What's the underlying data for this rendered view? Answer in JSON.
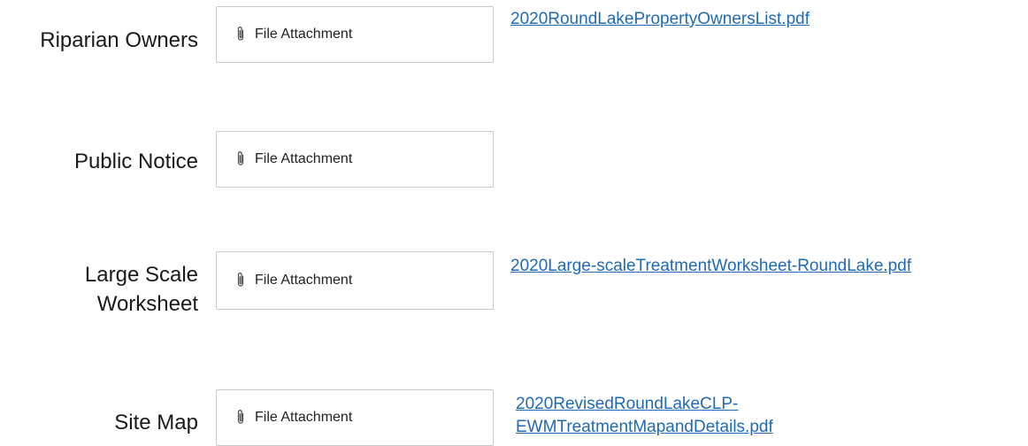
{
  "rows": [
    {
      "label": "Riparian Owners",
      "attachment_label": "File Attachment",
      "icon": "paperclip-icon",
      "file_link": "2020RoundLakePropertyOwnersList.pdf"
    },
    {
      "label": "Public Notice",
      "attachment_label": "File Attachment",
      "icon": "paperclip-icon"
    },
    {
      "label_line1": "Large Scale",
      "label_line2": "Worksheet",
      "attachment_label": "File Attachment",
      "icon": "paperclip-icon",
      "file_link": "2020Large-scaleTreatmentWorksheet-RoundLake.pdf"
    },
    {
      "label": "Site Map",
      "attachment_label": "File Attachment",
      "icon": "paperclip-icon",
      "file_link_line1": "2020RevisedRoundLakeCLP-",
      "file_link_line2": "EWMTreatmentMapandDetails.pdf"
    }
  ],
  "colors": {
    "link": "#1f6ab8",
    "label": "#1a1a1a",
    "border": "#c9c9c9"
  }
}
